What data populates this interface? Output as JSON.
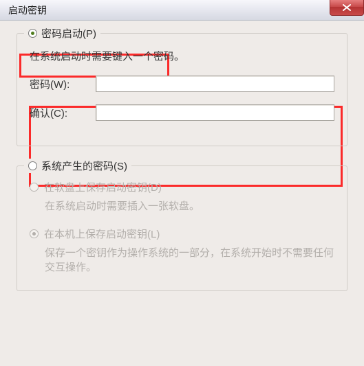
{
  "titlebar": {
    "title": "启动密钥"
  },
  "group_password": {
    "legend": "密码启动(P)",
    "desc": "在系统启动时需要键入一个密码。",
    "password_label": "密码(W):",
    "confirm_label": "确认(C):",
    "password_value": "",
    "confirm_value": ""
  },
  "group_system": {
    "legend": "系统产生的密码(S)",
    "opt_floppy": "在软盘上保存启动密钥(D)",
    "opt_floppy_desc": "在系统启动时需要插入一张软盘。",
    "opt_local": "在本机上保存启动密钥(L)",
    "opt_local_desc": "保存一个密钥作为操作系统的一部分，在系统开始时不需要任何交互操作。"
  },
  "state": {
    "main_selection": "password",
    "system_selection": "local"
  }
}
